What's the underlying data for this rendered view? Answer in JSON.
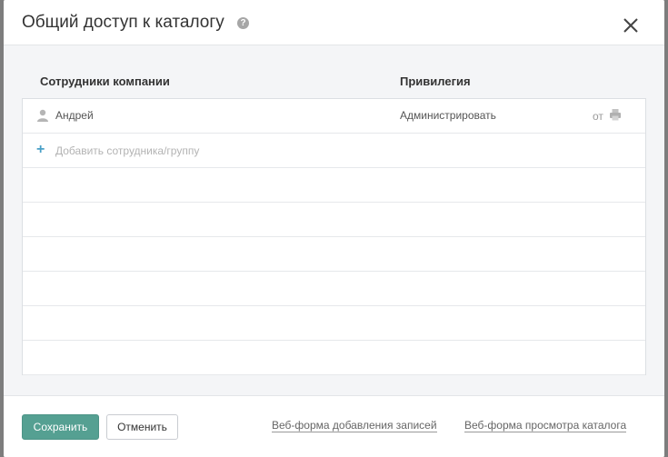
{
  "dialog": {
    "title": "Общий доступ к каталогу",
    "help_glyph": "?",
    "close_icon": "close-icon"
  },
  "columns": {
    "employees": "Сотрудники компании",
    "privilege": "Привилегия"
  },
  "rows": [
    {
      "name": "Андрей",
      "privilege": "Администрировать",
      "from_label": "от",
      "icon": "user-icon",
      "action_icon": "printer-icon"
    }
  ],
  "add_row": {
    "plus_glyph": "+",
    "label": "Добавить сотрудника/группу"
  },
  "footer": {
    "save_label": "Сохранить",
    "cancel_label": "Отменить",
    "add_form_link": "Веб-форма добавления записей",
    "view_form_link": "Веб-форма просмотра каталога"
  },
  "colors": {
    "primary_button": "#55a092",
    "accent_plus": "#4aa0c7"
  }
}
